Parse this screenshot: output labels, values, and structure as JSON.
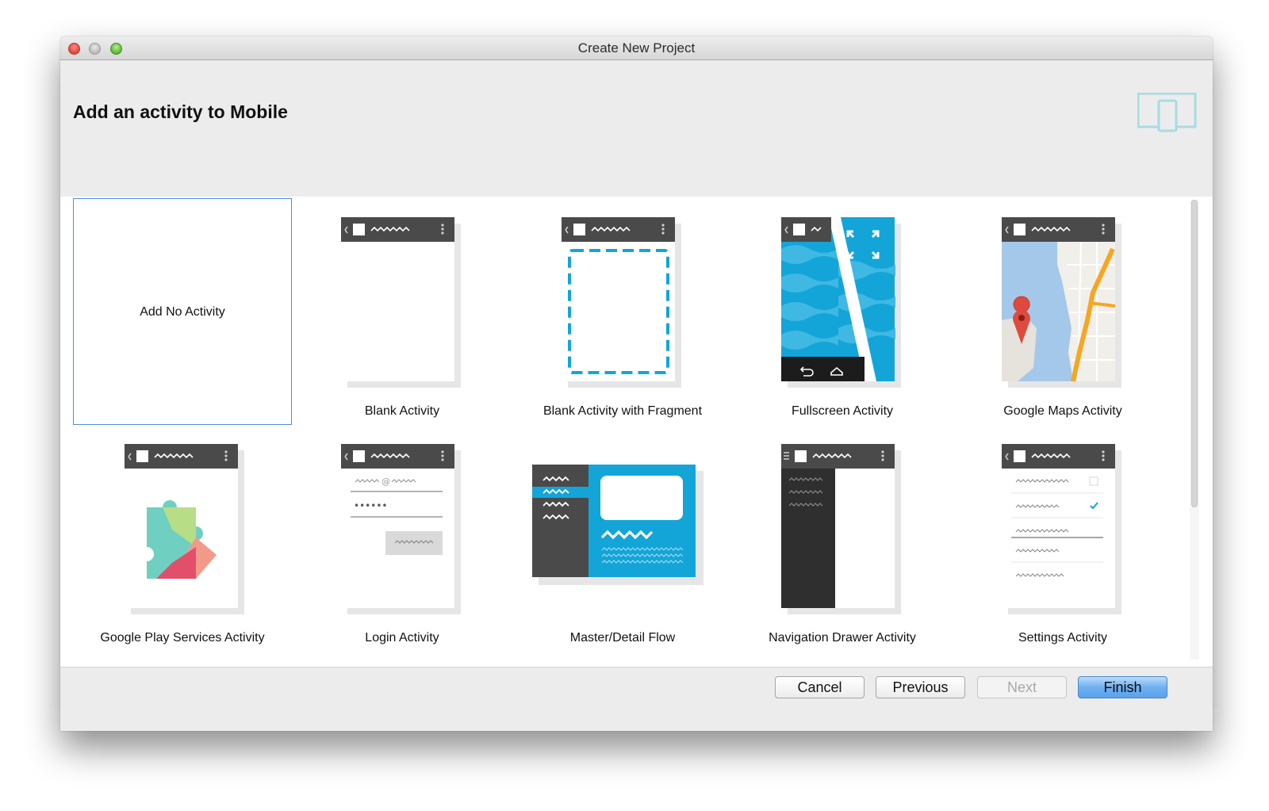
{
  "window": {
    "title": "Create New Project"
  },
  "header": {
    "title": "Add an activity to Mobile",
    "icon": "device-icon"
  },
  "gallery": {
    "items": [
      {
        "label": "Add No Activity",
        "selected": true
      },
      {
        "label": "Blank Activity"
      },
      {
        "label": "Blank Activity with Fragment"
      },
      {
        "label": "Fullscreen Activity"
      },
      {
        "label": "Google Maps Activity"
      },
      {
        "label": "Google Play Services Activity"
      },
      {
        "label": "Login Activity"
      },
      {
        "label": "Master/Detail Flow"
      },
      {
        "label": "Navigation Drawer Activity"
      },
      {
        "label": "Settings Activity"
      }
    ]
  },
  "login_preview": {
    "email_field": "@",
    "password_field": "••••••"
  },
  "buttons": {
    "cancel": "Cancel",
    "previous": "Previous",
    "next": "Next",
    "finish": "Finish"
  },
  "colors": {
    "accent": "#4f8fd6",
    "cyan": "#13a5d8",
    "dark": "#4a4a4a",
    "finish_button": "#6fb0f1"
  }
}
